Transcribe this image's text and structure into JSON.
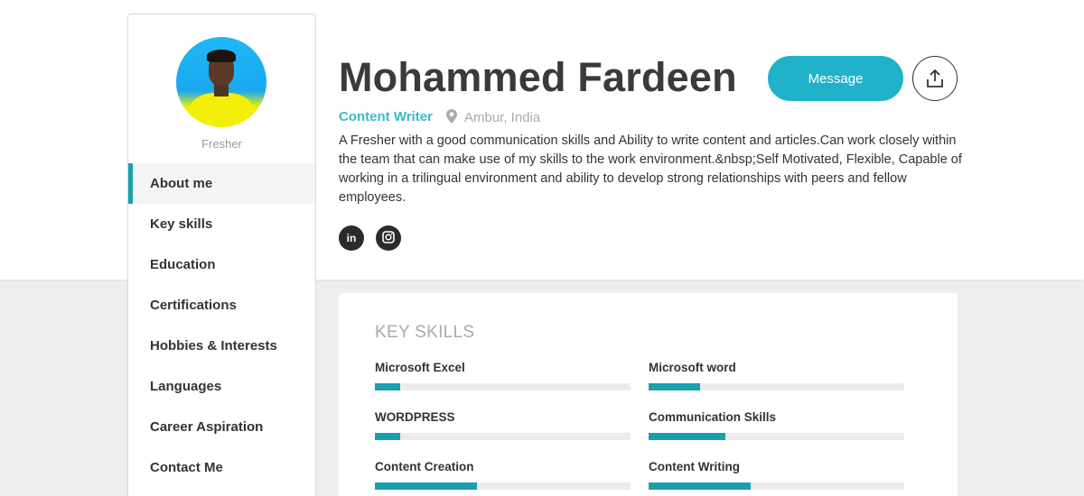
{
  "profile": {
    "name": "Mohammed Fardeen",
    "role": "Content Writer",
    "location": "Ambur, India",
    "status": "Fresher",
    "bio": "A Fresher with a good communication skills and Ability to write content and articles.Can work closely within the team that can make use of my skills to the work environment.&nbsp;Self Motivated, Flexible, Capable of working in a trilingual environment and ability to develop strong relationships with peers and fellow employees."
  },
  "actions": {
    "message_label": "Message",
    "share_icon": "share-icon"
  },
  "social": [
    {
      "icon": "linkedin-icon",
      "glyph": "in"
    },
    {
      "icon": "instagram-icon",
      "glyph": "◙"
    }
  ],
  "nav": [
    {
      "label": "About me",
      "active": true
    },
    {
      "label": "Key skills",
      "active": false
    },
    {
      "label": "Education",
      "active": false
    },
    {
      "label": "Certifications",
      "active": false
    },
    {
      "label": "Hobbies & Interests",
      "active": false
    },
    {
      "label": "Languages",
      "active": false
    },
    {
      "label": "Career Aspiration",
      "active": false
    },
    {
      "label": "Contact Me",
      "active": false
    }
  ],
  "skills_card": {
    "title": "KEY SKILLS",
    "skills": [
      {
        "label": "Microsoft Excel",
        "level": 0.1
      },
      {
        "label": "Microsoft word",
        "level": 0.2
      },
      {
        "label": "WORDPRESS",
        "level": 0.1
      },
      {
        "label": "Communication Skills",
        "level": 0.3
      },
      {
        "label": "Content Creation",
        "level": 0.4
      },
      {
        "label": "Content Writing",
        "level": 0.4
      }
    ]
  },
  "colors": {
    "accent": "#1fb2c9",
    "role_text": "#3cb8c7",
    "bar_fill": "#1a9fb0"
  }
}
